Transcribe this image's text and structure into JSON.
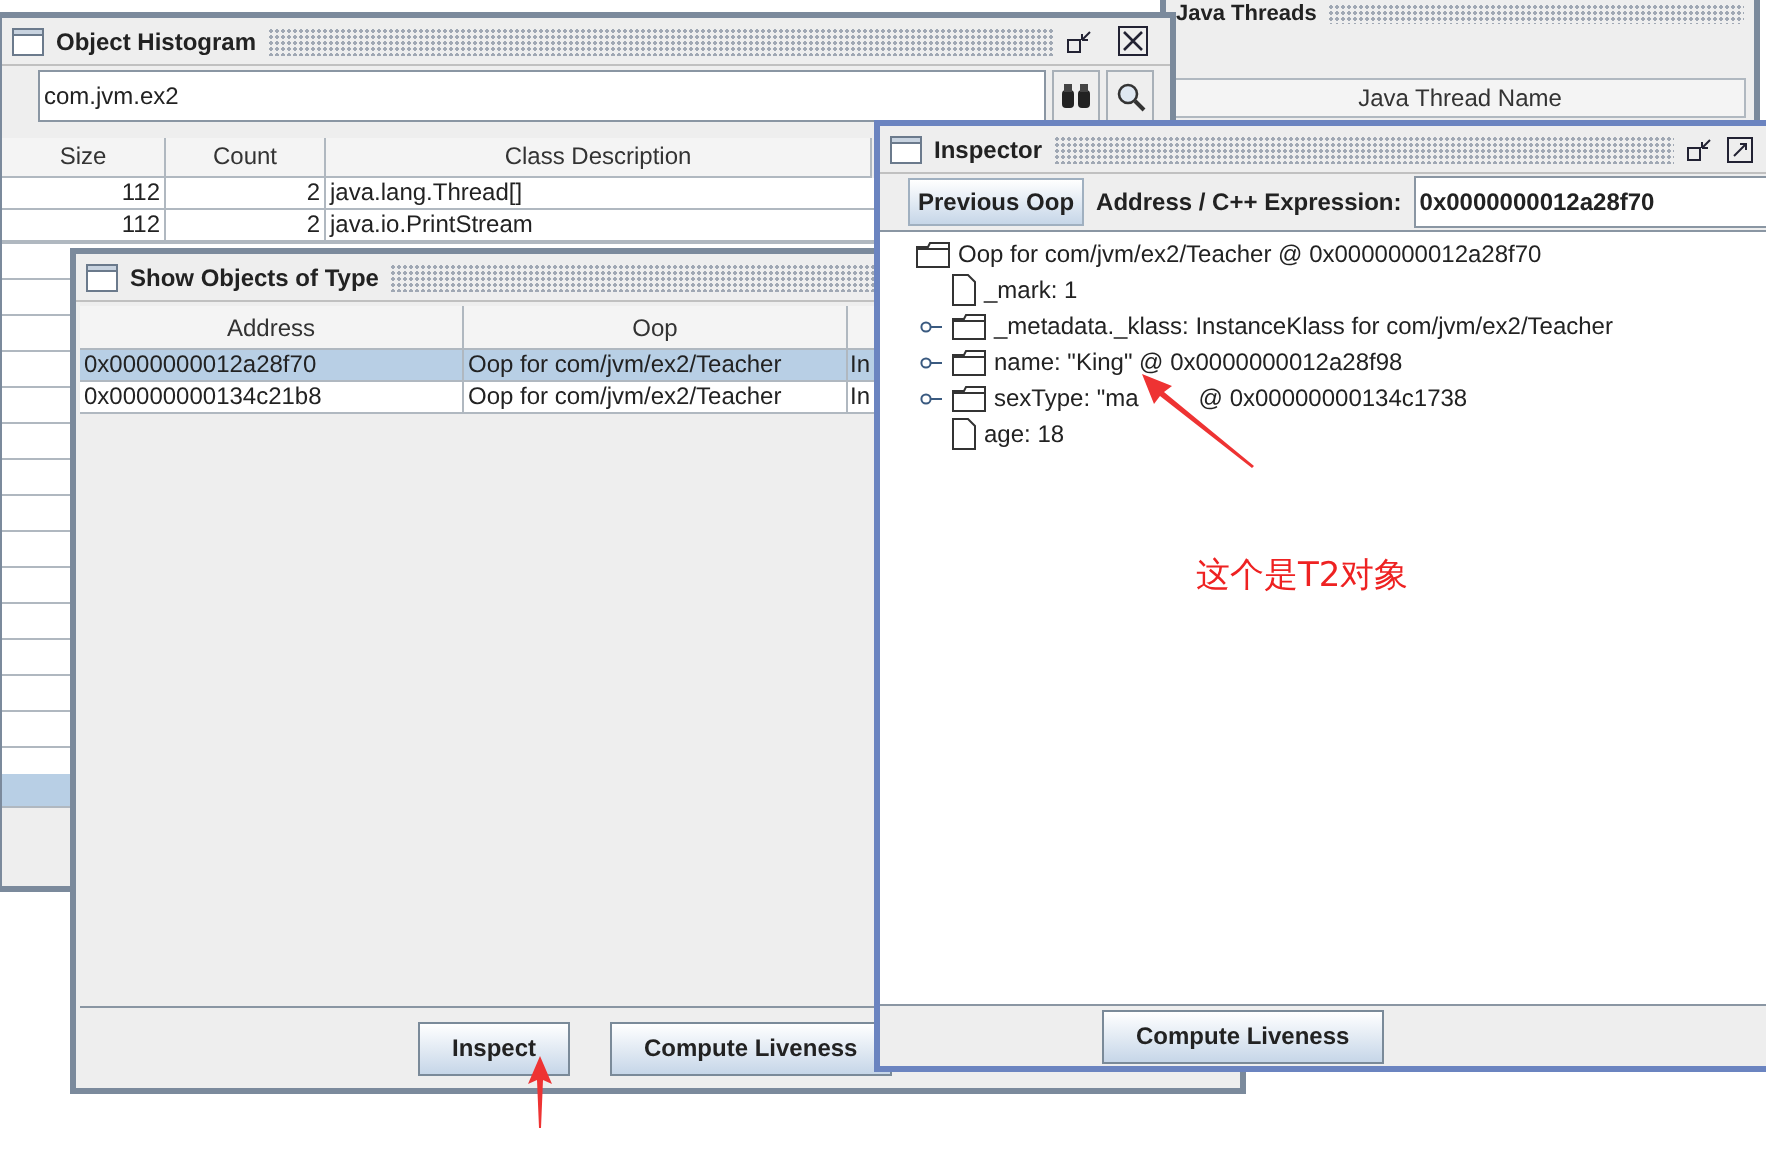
{
  "background_window": {
    "title": "Java Threads",
    "columns": [
      "Java Thread Name"
    ]
  },
  "histogram": {
    "title": "Object Histogram",
    "search": {
      "value": "com.jvm.ex2"
    },
    "columns": [
      "Size",
      "Count",
      "Class Description"
    ],
    "rows": [
      {
        "size": "112",
        "count": "2",
        "class_description": "java.lang.Thread[]"
      },
      {
        "size": "112",
        "count": "2",
        "class_description": "java.io.PrintStream"
      }
    ]
  },
  "show_objects": {
    "title": "Show Objects of Type",
    "columns": [
      "Address",
      "Oop"
    ],
    "rows": [
      {
        "address": "0x0000000012a28f70",
        "oop": "Oop for com/jvm/ex2/Teacher",
        "column_3": "In",
        "selected": true
      },
      {
        "address": "0x00000000134c21b8",
        "oop": "Oop for com/jvm/ex2/Teacher",
        "column_3": "In",
        "selected": false
      }
    ],
    "buttons": [
      "Inspect",
      "Compute Liveness"
    ]
  },
  "inspector": {
    "title": "Inspector",
    "previous_button": "Previous Oop",
    "address_label": "Address / C++ Expression:",
    "address_value": "0x0000000012a28f70",
    "tree": [
      {
        "label": "Oop for com/jvm/ex2/Teacher @ 0x0000000012a28f70",
        "kind": "folder",
        "expandable": false,
        "children": [
          {
            "label": "_mark: 1",
            "kind": "file",
            "expandable": false
          },
          {
            "label": "_metadata._klass: InstanceKlass for com/jvm/ex2/Teacher",
            "kind": "folder",
            "expandable": true
          },
          {
            "label": "name: \"King\" @ 0x0000000012a28f98",
            "kind": "folder",
            "expandable": true
          },
          {
            "label": "sexType: \"ma",
            "label_after": "@ 0x00000000134c1738",
            "kind": "folder",
            "expandable": true
          },
          {
            "label": "age: 18",
            "kind": "file",
            "expandable": false
          }
        ]
      }
    ],
    "buttons": [
      "Compute Liveness"
    ]
  },
  "annotation": {
    "text": "这个是T2对象"
  }
}
